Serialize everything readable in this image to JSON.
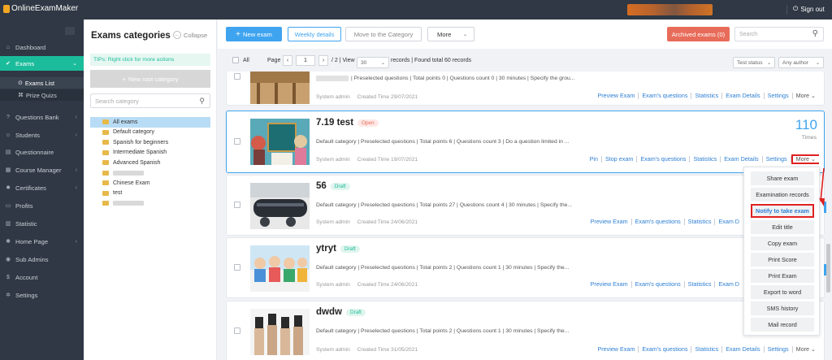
{
  "app": {
    "logo": "OnlineExamMaker",
    "signout": "Sign out"
  },
  "sidebar": {
    "items": [
      {
        "label": "Dashboard",
        "icon": "home-icon"
      },
      {
        "label": "Exams",
        "icon": "check-circle-icon",
        "active": true
      },
      {
        "label": "Questions Bank",
        "icon": "question-icon"
      },
      {
        "label": "Students",
        "icon": "users-icon"
      },
      {
        "label": "Questionnaire",
        "icon": "clipboard-icon"
      },
      {
        "label": "Course Manager",
        "icon": "grid-icon"
      },
      {
        "label": "Certificates",
        "icon": "gear-icon"
      },
      {
        "label": "Profits",
        "icon": "card-icon"
      },
      {
        "label": "Statistic",
        "icon": "bar-chart-icon"
      },
      {
        "label": "Home Page",
        "icon": "star-icon"
      },
      {
        "label": "Sub Admins",
        "icon": "user-circle-icon"
      },
      {
        "label": "Account",
        "icon": "dollar-icon"
      },
      {
        "label": "Settings",
        "icon": "settings-icon"
      }
    ],
    "sub": [
      {
        "label": "Exams List",
        "selected": true
      },
      {
        "label": "Prize Quizs"
      }
    ]
  },
  "categories": {
    "title": "Exams categories",
    "collapse": "Collapse",
    "tips": "TIPs: Right click for more actions",
    "new_root": "New root category",
    "search_placeholder": "Search category",
    "tree": [
      {
        "label": "All exams",
        "selected": true
      },
      {
        "label": "Default category"
      },
      {
        "label": "Spanish for beginners"
      },
      {
        "label": "Intermediate Spanish"
      },
      {
        "label": "Advanced Spanish"
      },
      {
        "label": ""
      },
      {
        "label": "Chinese Exam"
      },
      {
        "label": "test"
      },
      {
        "label": ""
      }
    ]
  },
  "toolbar": {
    "new_exam": "New exam",
    "weekly": "Weekly details",
    "move": "Move to the Category",
    "more": "More",
    "archived": "Archived exams (0)",
    "search_placeholder": "Search"
  },
  "pager": {
    "all": "All",
    "page_label": "Page",
    "page": "1",
    "total_pages": "/ 2 | View",
    "per_page": "30",
    "summary": "records | Found total 60 records",
    "status_filter": "Test status",
    "author_filter": "Any author"
  },
  "exams": [
    {
      "title": "",
      "status": "",
      "desc": "| Preselected questions | Total points 0 | Questions count 0 | 30 minutes | Specify the grou...",
      "author": "System admin",
      "created": "Created Time 29/07/2021",
      "actions": [
        "Preview Exam",
        "Exam's questions",
        "Statistics",
        "Exam Details",
        "Settings"
      ],
      "more": "More"
    },
    {
      "title": "7.19 test",
      "status": "Open",
      "desc": "Default category | Preselected questions | Total points 6 | Questions count 3 | Do a question limited in ...",
      "author": "System admin",
      "created": "Created Time 19/07/2021",
      "actions": [
        "Pin",
        "Stop exam",
        "Exam's questions",
        "Statistics",
        "Exam Details",
        "Settings"
      ],
      "more": "More",
      "count": "110",
      "count_label": "Times"
    },
    {
      "title": "56",
      "status": "Draft",
      "desc": "Default category | Preselected questions | Total points 27 | Questions count 4 | 30 minutes | Specify the...",
      "author": "System admin",
      "created": "Created Time 24/06/2021",
      "actions": [
        "Preview Exam",
        "Exam's questions",
        "Statistics",
        "Exam D"
      ]
    },
    {
      "title": "ytryt",
      "status": "Draft",
      "desc": "Default category | Preselected questions | Total points 2 | Questions count 1 | 30 minutes | Specify the...",
      "author": "System admin",
      "created": "Created Time 24/06/2021",
      "actions": [
        "Preview Exam",
        "Exam's questions",
        "Statistics",
        "Exam D"
      ]
    },
    {
      "title": "dwdw",
      "status": "Draft",
      "desc": "Default category | Preselected questions | Total points 2 | Questions count 1 | 30 minutes | Specify the...",
      "author": "System admin",
      "created": "Created Time 31/05/2021",
      "actions": [
        "Preview Exam",
        "Exam's questions",
        "Statistics",
        "Exam Details",
        "Settings"
      ],
      "more": "More"
    }
  ],
  "more_menu": [
    "Share exam",
    "Examination records",
    "Notify to take exam",
    "Edit title",
    "Copy exam",
    "Print Score",
    "Print Exam",
    "Export to word",
    "SMS history",
    "Mail record"
  ]
}
